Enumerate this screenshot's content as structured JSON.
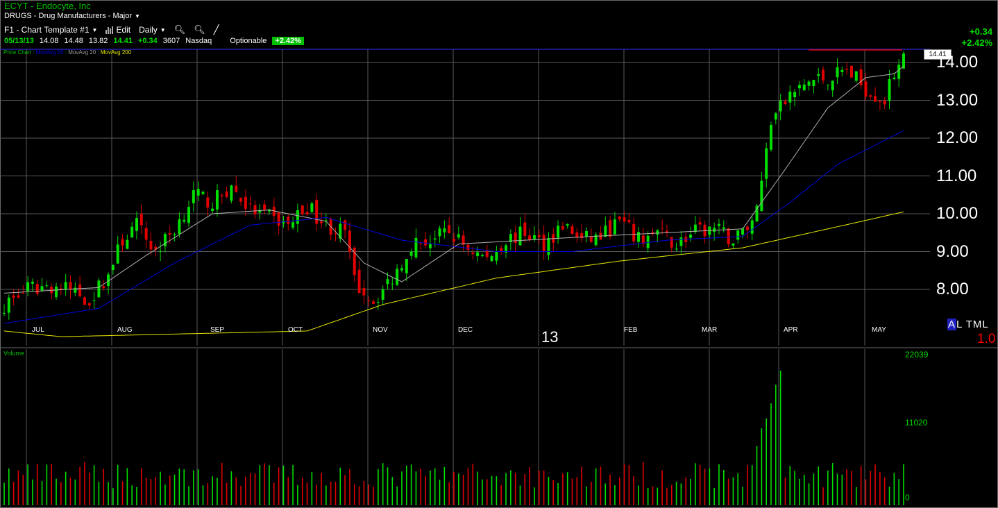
{
  "header": {
    "title": "ECYT - Endocyte, Inc",
    "industry": "DRUGS - Drug Manufacturers - Major"
  },
  "toolbar": {
    "template": "F1 - Chart Template #1",
    "edit": "Edit",
    "period": "Daily"
  },
  "quote": {
    "date": "05/13/13",
    "open": "14.08",
    "high": "14.48",
    "low": "13.82",
    "last": "14.41",
    "change": "+0.34",
    "volume": "3607",
    "exchange": "Nasdaq",
    "optionable": "Optionable",
    "pct_badge": "+2.42%"
  },
  "right_change": {
    "abs": "+0.34",
    "pct": "+2.42%"
  },
  "legend": {
    "price": "Price Chart :",
    "ma50": "MovAvg 50",
    "ma20": "MovAvg 20",
    "ma200": "MovAvg 200",
    "sep1": ":",
    "sep2": ":"
  },
  "price_box": "14.41",
  "volume_label": "Volume",
  "year_label": "13",
  "altml": {
    "a": "A",
    "rest": "L TML"
  },
  "scale": "1.0",
  "volume_axis": [
    "22039",
    "11020",
    "0"
  ],
  "colors": {
    "up": "#00e000",
    "down": "#e00000",
    "ma50": "#0000e0",
    "ma20": "#b0b0b0",
    "ma200": "#e8e800",
    "grid": "#5a5a5a"
  },
  "chart_data": {
    "type": "candlestick",
    "symbol": "ECYT",
    "y_ticks": [
      "14.00",
      "13.00",
      "12.00",
      "11.00",
      "10.00",
      "9.00",
      "8.00"
    ],
    "months": [
      "JUL",
      "AUG",
      "SEP",
      "OCT",
      "NOV",
      "DEC",
      "FEB",
      "MAR",
      "APR",
      "MAY"
    ],
    "ylim": [
      7.0,
      14.35
    ],
    "close_path": [
      [
        0,
        7.6
      ],
      [
        5,
        8.0
      ],
      [
        10,
        8.1
      ],
      [
        15,
        7.95
      ],
      [
        18,
        7.7
      ],
      [
        22,
        8.4
      ],
      [
        25,
        9.3
      ],
      [
        28,
        9.7
      ],
      [
        32,
        9.0
      ],
      [
        36,
        9.6
      ],
      [
        40,
        10.5
      ],
      [
        44,
        10.3
      ],
      [
        48,
        10.7
      ],
      [
        52,
        10.1
      ],
      [
        56,
        9.9
      ],
      [
        60,
        9.7
      ],
      [
        64,
        10.2
      ],
      [
        68,
        9.7
      ],
      [
        72,
        9.5
      ],
      [
        74,
        8.2
      ],
      [
        78,
        7.7
      ],
      [
        82,
        8.3
      ],
      [
        86,
        9.2
      ],
      [
        90,
        9.3
      ],
      [
        94,
        9.5
      ],
      [
        98,
        9.1
      ],
      [
        102,
        8.8
      ],
      [
        106,
        9.3
      ],
      [
        110,
        9.5
      ],
      [
        114,
        9.2
      ],
      [
        118,
        9.7
      ],
      [
        122,
        9.3
      ],
      [
        126,
        9.4
      ],
      [
        130,
        9.8
      ],
      [
        134,
        9.3
      ],
      [
        138,
        9.5
      ],
      [
        142,
        9.2
      ],
      [
        146,
        9.5
      ],
      [
        150,
        9.6
      ],
      [
        154,
        9.3
      ],
      [
        158,
        9.8
      ],
      [
        160,
        10.8
      ],
      [
        162,
        12.5
      ],
      [
        166,
        13.1
      ],
      [
        170,
        13.5
      ],
      [
        174,
        13.6
      ],
      [
        178,
        13.8
      ],
      [
        182,
        13.3
      ],
      [
        186,
        13.0
      ],
      [
        188,
        13.7
      ],
      [
        190,
        14.41
      ]
    ],
    "ma20_path": [
      [
        0,
        7.9
      ],
      [
        20,
        8.05
      ],
      [
        30,
        8.9
      ],
      [
        44,
        10.0
      ],
      [
        56,
        10.1
      ],
      [
        68,
        9.8
      ],
      [
        76,
        8.7
      ],
      [
        84,
        8.2
      ],
      [
        96,
        9.2
      ],
      [
        110,
        9.3
      ],
      [
        124,
        9.4
      ],
      [
        140,
        9.5
      ],
      [
        156,
        9.6
      ],
      [
        164,
        11.0
      ],
      [
        174,
        12.8
      ],
      [
        182,
        13.6
      ],
      [
        188,
        13.7
      ],
      [
        190,
        13.9
      ]
    ],
    "ma50_path": [
      [
        0,
        7.1
      ],
      [
        20,
        7.5
      ],
      [
        36,
        8.7
      ],
      [
        52,
        9.7
      ],
      [
        68,
        9.9
      ],
      [
        84,
        9.3
      ],
      [
        104,
        9.0
      ],
      [
        120,
        9.0
      ],
      [
        140,
        9.3
      ],
      [
        156,
        9.4
      ],
      [
        166,
        10.3
      ],
      [
        176,
        11.3
      ],
      [
        190,
        12.2
      ]
    ],
    "ma200_path": [
      [
        0,
        6.9
      ],
      [
        12,
        6.75
      ],
      [
        64,
        6.9
      ],
      [
        80,
        7.6
      ],
      [
        104,
        8.3
      ],
      [
        130,
        8.75
      ],
      [
        156,
        9.1
      ],
      [
        174,
        9.6
      ],
      [
        190,
        10.05
      ]
    ],
    "volume_max": 22039
  }
}
